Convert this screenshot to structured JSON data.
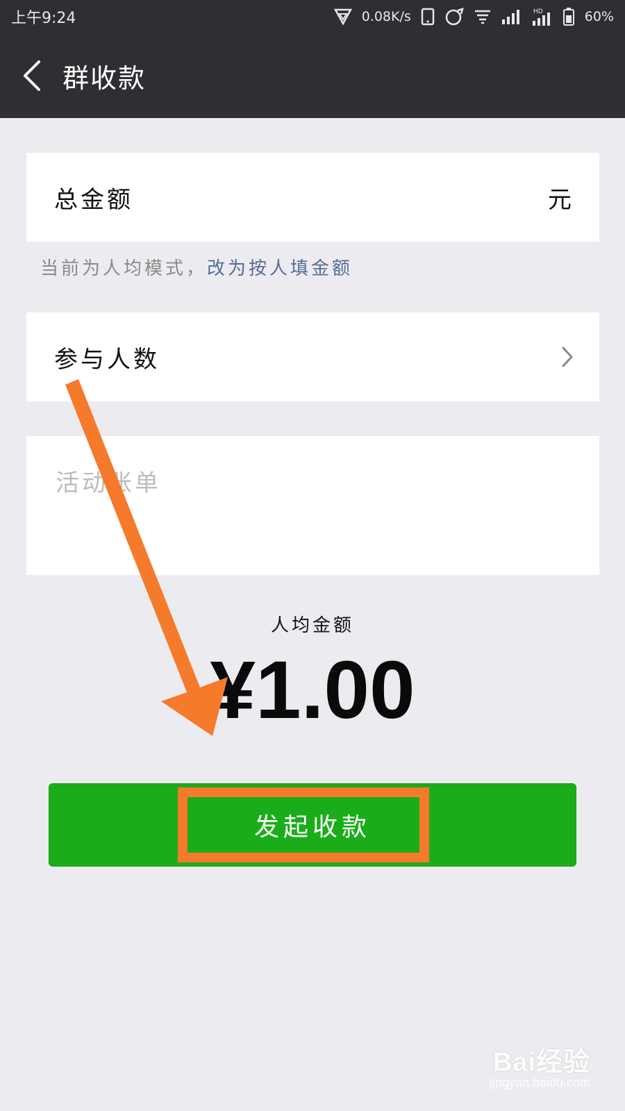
{
  "status_bar": {
    "time": "上午9:24",
    "network_speed": "0.08K/s",
    "battery": "60%"
  },
  "header": {
    "title": "群收款"
  },
  "form": {
    "total_label": "总金额",
    "total_unit": "元",
    "mode_text": "当前为人均模式，",
    "mode_link": "改为按人填金额",
    "participants_label": "参与人数",
    "bill_placeholder": "活动账单"
  },
  "summary": {
    "per_person_label": "人均金额",
    "per_person_amount": "¥1.00"
  },
  "actions": {
    "submit_label": "发起收款"
  },
  "watermark": {
    "logo": "Bai经验",
    "url": "jingyan.baidu.com"
  },
  "colors": {
    "header_bg": "#2f2f33",
    "page_bg": "#ececf0",
    "primary_green": "#1aad19",
    "link_blue": "#576b95",
    "annotation_orange": "#f57a2b"
  }
}
